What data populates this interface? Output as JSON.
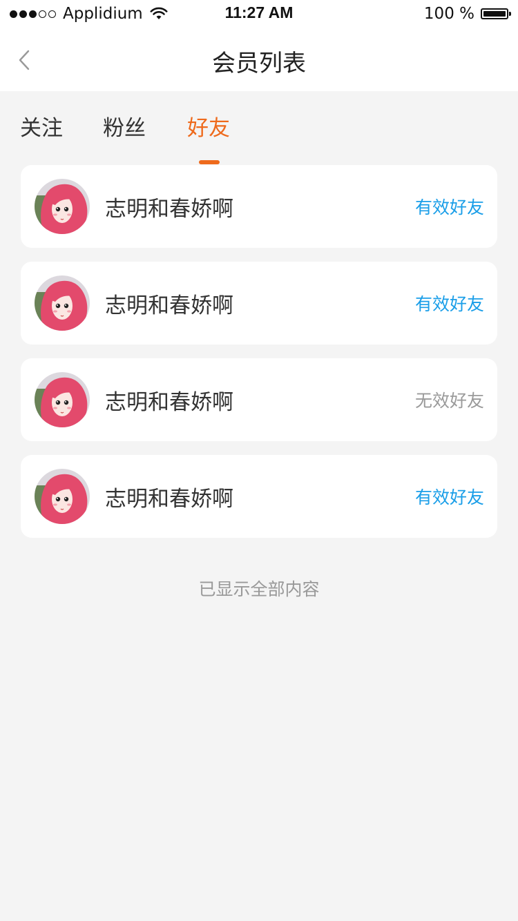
{
  "status_bar": {
    "carrier": "Applidium",
    "time": "11:27 AM",
    "battery": "100 %",
    "battery_level": 1.0
  },
  "nav": {
    "title": "会员列表",
    "back_icon": "chevron-left-icon"
  },
  "tabs": [
    {
      "label": "关注",
      "active": false
    },
    {
      "label": "粉丝",
      "active": false
    },
    {
      "label": "好友",
      "active": true
    }
  ],
  "members": [
    {
      "name": "志明和春娇啊",
      "status": "有效好友",
      "valid": true
    },
    {
      "name": "志明和春娇啊",
      "status": "有效好友",
      "valid": true
    },
    {
      "name": "志明和春娇啊",
      "status": "无效好友",
      "valid": false
    },
    {
      "name": "志明和春娇啊",
      "status": "有效好友",
      "valid": true
    }
  ],
  "footer": {
    "text": "已显示全部内容"
  },
  "colors": {
    "accent": "#ee6a1c",
    "valid": "#1a9ee8",
    "invalid": "#9a9a9a",
    "background": "#f4f4f4"
  }
}
